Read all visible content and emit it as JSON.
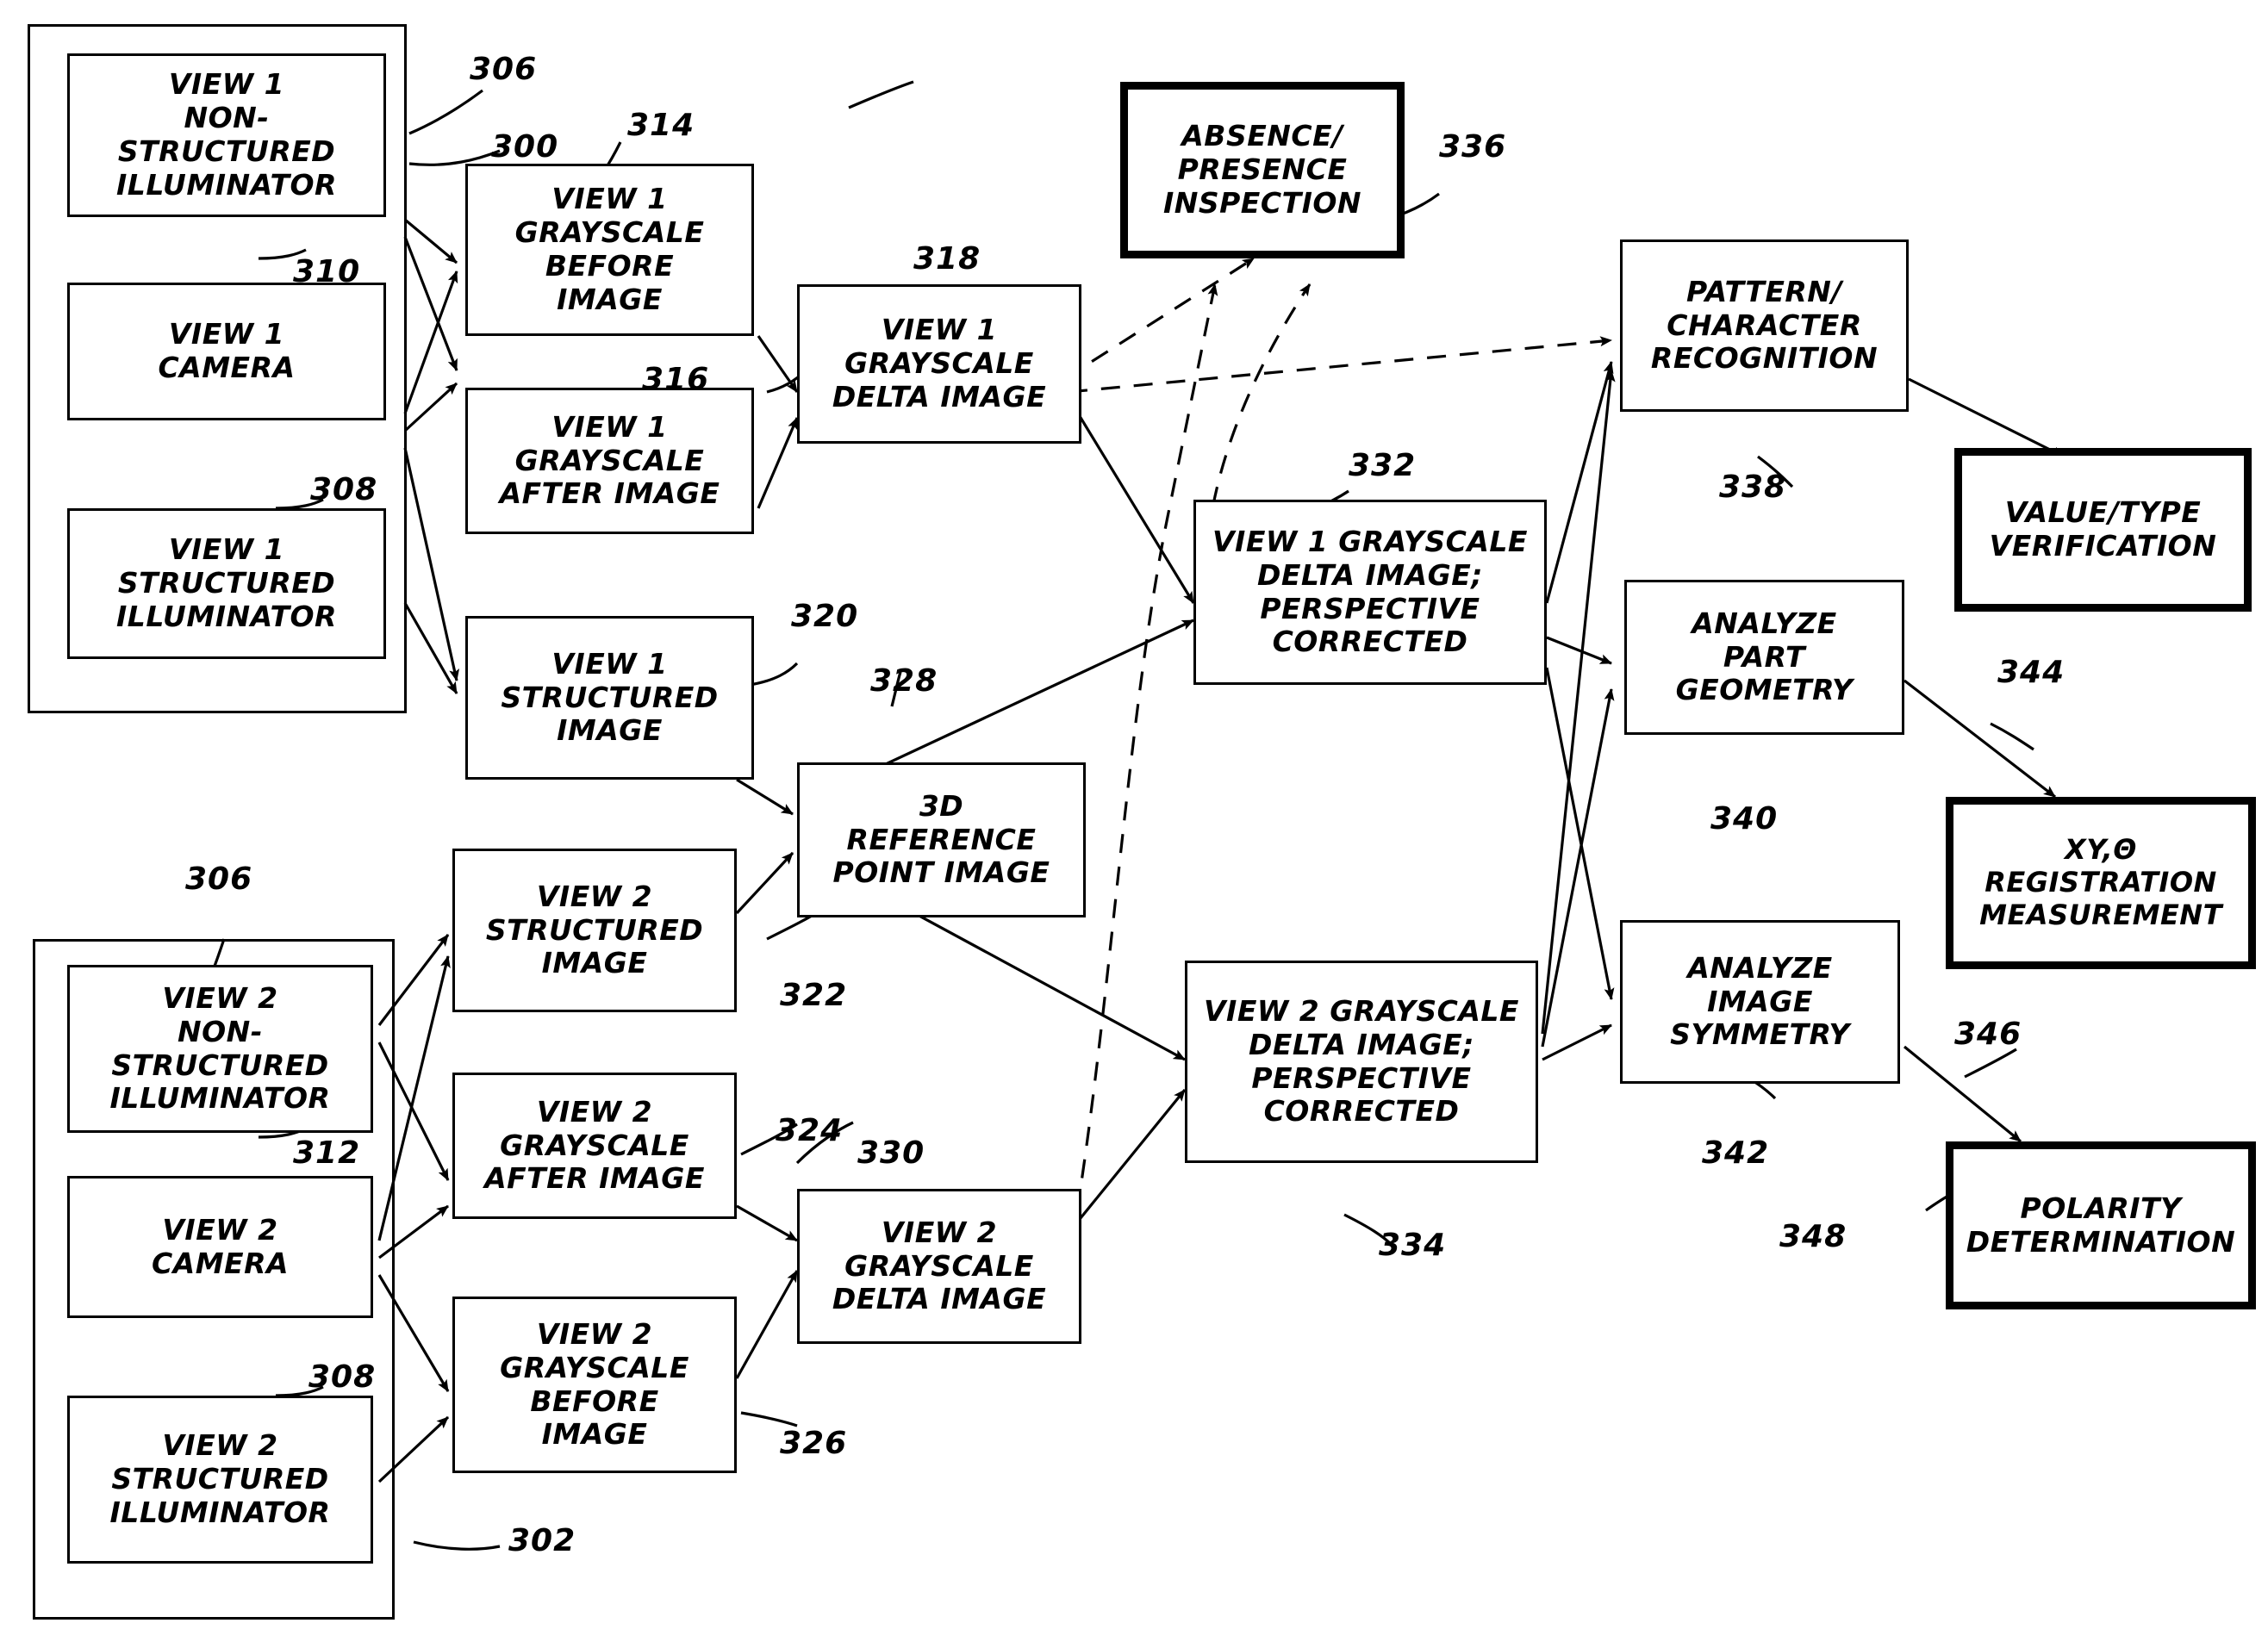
{
  "diagram": {
    "title": "Machine Vision Multi-View Inspection Flow Diagram",
    "line_color": "#000000",
    "background": "#ffffff"
  },
  "groups": [
    {
      "id": "view1-assembly",
      "ref": "300"
    },
    {
      "id": "view2-assembly",
      "ref": "302"
    }
  ],
  "nodes": {
    "view1_nonstructured_illuminator": {
      "label": "VIEW 1\nNON-\nSTRUCTURED\nILLUMINATOR",
      "ref": "306"
    },
    "view1_camera": {
      "label": "VIEW 1\nCAMERA",
      "ref": "310"
    },
    "view1_structured_illuminator": {
      "label": "VIEW 1\nSTRUCTURED\nILLUMINATOR",
      "ref": "308"
    },
    "view1_grayscale_before_image": {
      "label": "VIEW 1\nGRAYSCALE\nBEFORE\nIMAGE",
      "ref": "314"
    },
    "view1_grayscale_after_image": {
      "label": "VIEW 1\nGRAYSCALE\nAFTER IMAGE",
      "ref": "316"
    },
    "view1_structured_image": {
      "label": "VIEW 1\nSTRUCTURED\nIMAGE",
      "ref": "320"
    },
    "view1_grayscale_delta_image": {
      "label": "VIEW 1\nGRAYSCALE\nDELTA IMAGE",
      "ref": "318"
    },
    "reference_point_image_3d": {
      "label": "3D\nREFERENCE\nPOINT IMAGE",
      "ref": "328"
    },
    "view2_nonstructured_illuminator": {
      "label": "VIEW 2\nNON-\nSTRUCTURED\nILLUMINATOR",
      "ref": "306"
    },
    "view2_camera": {
      "label": "VIEW 2\nCAMERA",
      "ref": "312"
    },
    "view2_structured_illuminator": {
      "label": "VIEW 2\nSTRUCTURED\nILLUMINATOR",
      "ref": "308"
    },
    "view2_structured_image": {
      "label": "VIEW 2\nSTRUCTURED\nIMAGE",
      "ref": "322"
    },
    "view2_grayscale_after_image": {
      "label": "VIEW 2\nGRAYSCALE\nAFTER IMAGE",
      "ref": "324"
    },
    "view2_grayscale_before_image": {
      "label": "VIEW 2\nGRAYSCALE\nBEFORE\nIMAGE",
      "ref": "326"
    },
    "view2_grayscale_delta_image": {
      "label": "VIEW 2\nGRAYSCALE\nDELTA IMAGE",
      "ref": "330"
    },
    "view1_delta_perspective_corrected": {
      "label": "VIEW 1 GRAYSCALE\nDELTA IMAGE;\nPERSPECTIVE\nCORRECTED",
      "ref": "332"
    },
    "view2_delta_perspective_corrected": {
      "label": "VIEW 2 GRAYSCALE\nDELTA IMAGE;\nPERSPECTIVE\nCORRECTED",
      "ref": "334"
    },
    "absence_presence_inspection": {
      "label": "ABSENCE/\nPRESENCE\nINSPECTION",
      "ref": "336"
    },
    "pattern_character_recognition": {
      "label": "PATTERN/\nCHARACTER\nRECOGNITION",
      "ref": "338"
    },
    "analyze_part_geometry": {
      "label": "ANALYZE\nPART\nGEOMETRY",
      "ref": "340"
    },
    "analyze_image_symmetry": {
      "label": "ANALYZE\nIMAGE\nSYMMETRY",
      "ref": "342"
    },
    "value_type_verification": {
      "label": "VALUE/TYPE\nVERIFICATION",
      "ref": "344"
    },
    "xy_theta_registration_measurement": {
      "label": "XY,Θ\nREGISTRATION\nMEASUREMENT",
      "ref": "346"
    },
    "polarity_determination": {
      "label": "POLARITY\nDETERMINATION",
      "ref": "348"
    }
  },
  "reference_numerals": [
    "300",
    "302",
    "306",
    "306",
    "308",
    "308",
    "310",
    "312",
    "314",
    "316",
    "318",
    "320",
    "322",
    "324",
    "326",
    "328",
    "330",
    "332",
    "334",
    "336",
    "338",
    "340",
    "342",
    "344",
    "346",
    "348"
  ]
}
